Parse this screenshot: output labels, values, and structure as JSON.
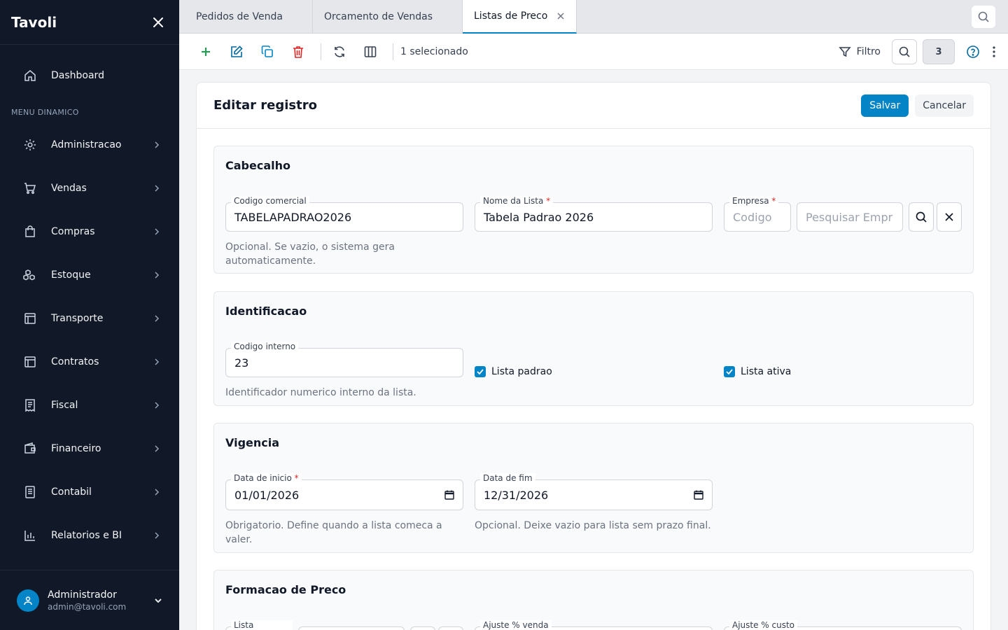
{
  "sidebar": {
    "brand": "Tavoli",
    "dashboard": "Dashboard",
    "section_label": "MENU DINAMICO",
    "items": [
      {
        "label": "Administracao"
      },
      {
        "label": "Vendas"
      },
      {
        "label": "Compras"
      },
      {
        "label": "Estoque"
      },
      {
        "label": "Transporte"
      },
      {
        "label": "Contratos"
      },
      {
        "label": "Fiscal"
      },
      {
        "label": "Financeiro"
      },
      {
        "label": "Contabil"
      },
      {
        "label": "Relatorios e BI"
      }
    ],
    "user": {
      "name": "Administrador",
      "email": "admin@tavoli.com"
    }
  },
  "tabs": [
    {
      "label": "Pedidos de Venda"
    },
    {
      "label": "Orcamento de Vendas"
    },
    {
      "label": "Listas de Preco"
    }
  ],
  "toolbar": {
    "selected_text": "1 selecionado",
    "filter_label": "Filtro",
    "count": "3"
  },
  "form": {
    "title": "Editar registro",
    "save": "Salvar",
    "cancel": "Cancelar",
    "cabecalho": {
      "title": "Cabecalho",
      "codigo_comercial": {
        "label": "Codigo comercial",
        "value": "TABELAPADRAO2026",
        "help": "Opcional. Se vazio, o sistema gera automaticamente."
      },
      "nome_lista": {
        "label": "Nome da Lista",
        "value": "Tabela Padrao 2026"
      },
      "empresa": {
        "label": "Empresa",
        "code_placeholder": "Codigo",
        "search_placeholder": "Pesquisar Empr"
      }
    },
    "identificacao": {
      "title": "Identificacao",
      "codigo_interno": {
        "label": "Codigo interno",
        "value": "23",
        "help": "Identificador numerico interno da lista."
      },
      "lista_padrao": "Lista padrao",
      "lista_ativa": "Lista ativa"
    },
    "vigencia": {
      "title": "Vigencia",
      "data_inicio": {
        "label": "Data de inicio",
        "value": "01/01/2026",
        "help": "Obrigatorio. Define quando a lista comeca a valer."
      },
      "data_fim": {
        "label": "Data de fim",
        "value": "12/31/2026",
        "help": "Opcional. Deixe vazio para lista sem prazo final."
      }
    },
    "formacao": {
      "title": "Formacao de Preco",
      "lista_herdada": "Lista herdada",
      "ajuste_venda": "Ajuste % venda",
      "ajuste_custo": "Ajuste % custo"
    }
  },
  "required_mark": "*",
  "colors": {
    "sidebar_bg": "#111827",
    "accent": "#0284c7",
    "danger": "#dc2626",
    "add": "#16a34a"
  }
}
